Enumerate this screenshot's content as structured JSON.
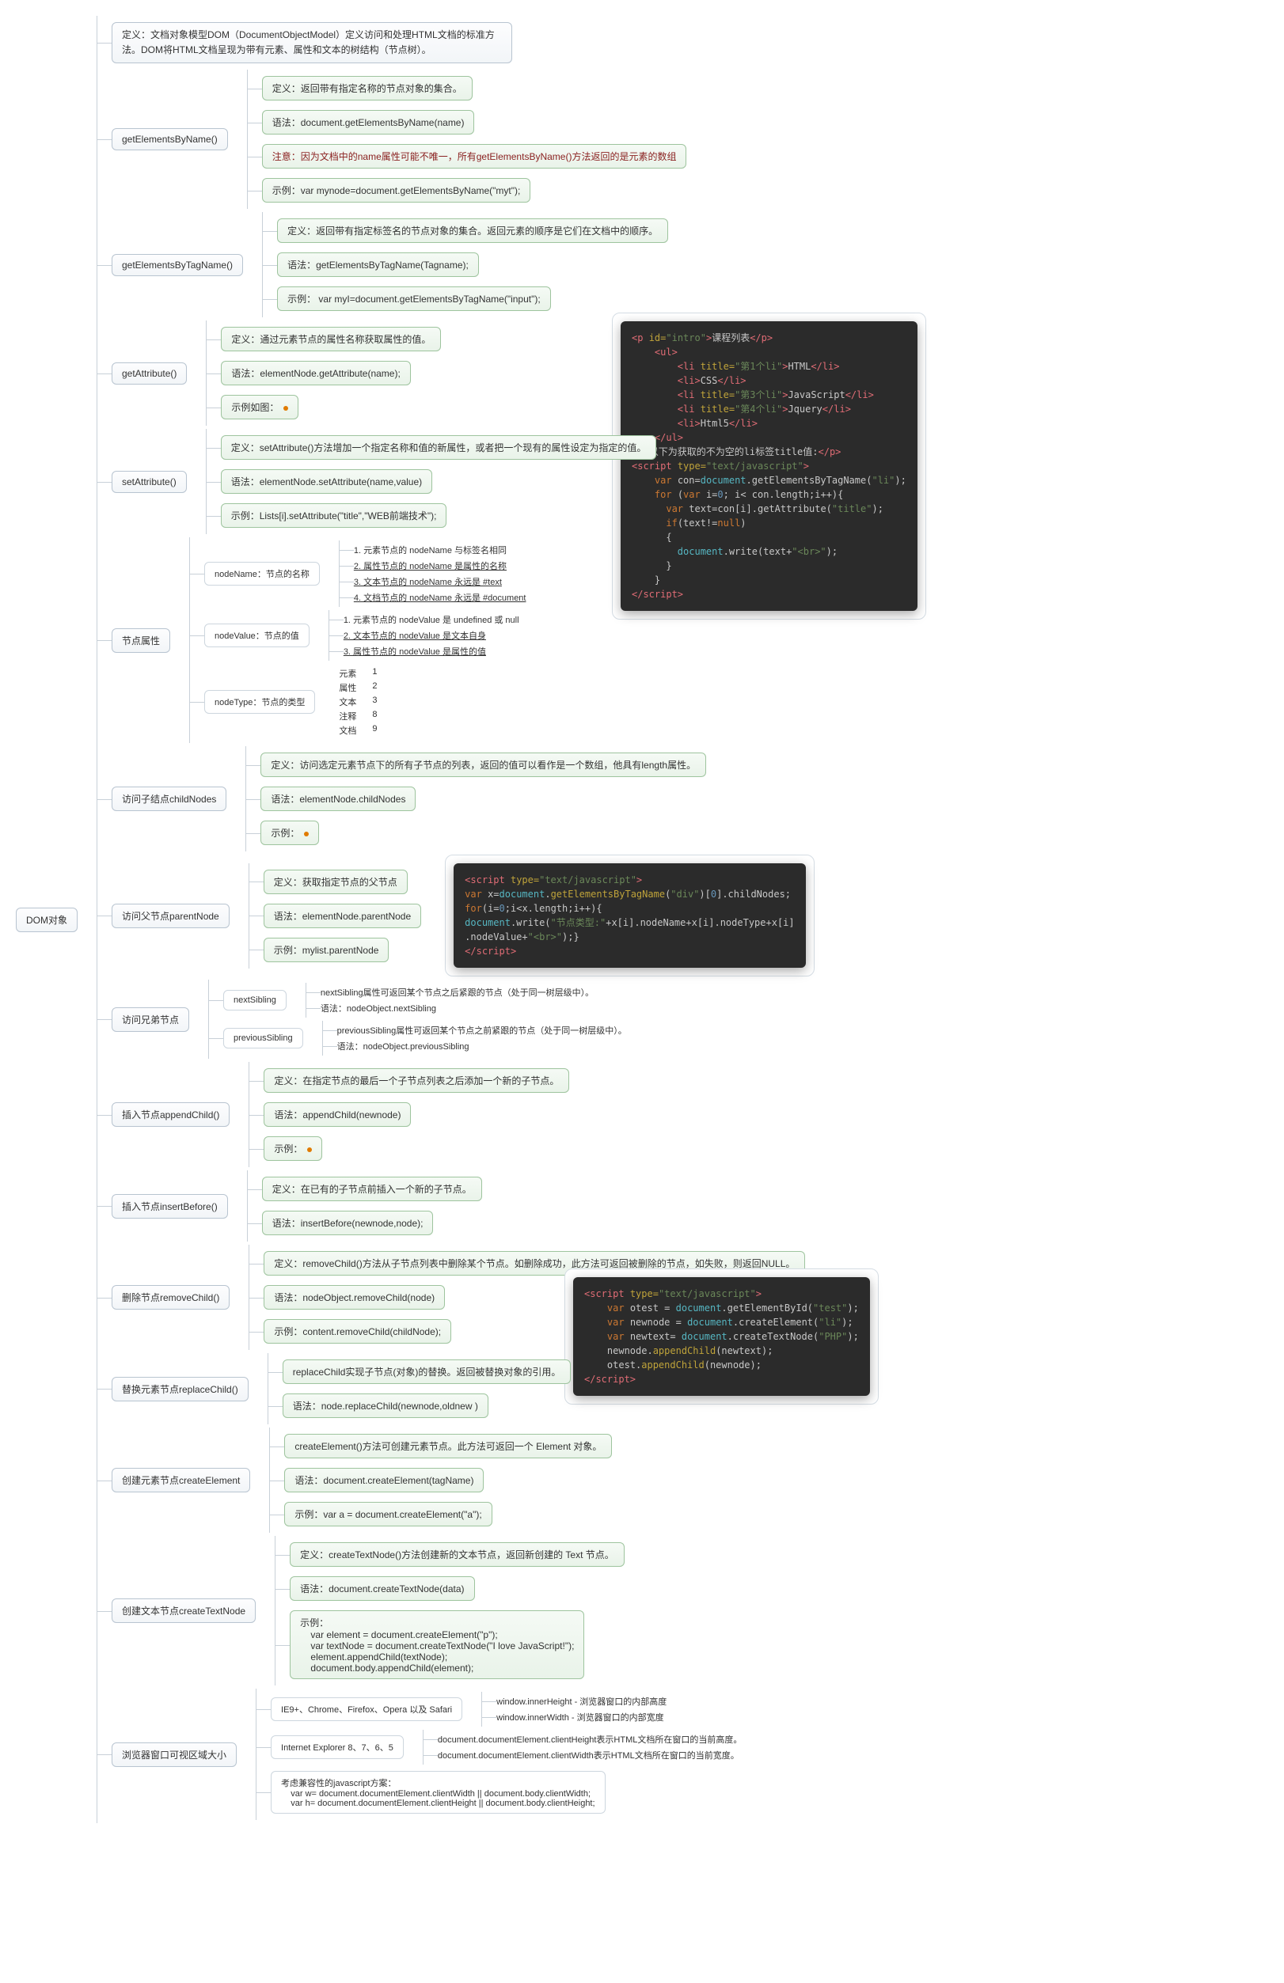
{
  "root": "DOM对象",
  "intro": "定义：文档对象模型DOM（DocumentObjectModel）定义访问和处理HTML文档的标准方法。DOM将HTML文档呈现为带有元素、属性和文本的树结构（节点树）。",
  "getElementsByName": {
    "title": "getElementsByName()",
    "def": "定义：返回带有指定名称的节点对象的集合。",
    "syntax": "语法：document.getElementsByName(name)",
    "note": "注意：因为文档中的name属性可能不唯一，所有getElementsByName()方法返回的是元素的数组",
    "example": "示例：var mynode=document.getElementsByName(\"myt\");"
  },
  "getElementsByTagName": {
    "title": "getElementsByTagName()",
    "def": "定义：返回带有指定标签名的节点对象的集合。返回元素的顺序是它们在文档中的顺序。",
    "syntax": "语法：getElementsByTagName(Tagname);",
    "example": "示例： var myI=document.getElementsByTagName(\"input\");"
  },
  "getAttribute": {
    "title": "getAttribute()",
    "def": "定义：通过元素节点的属性名称获取属性的值。",
    "syntax": "语法：elementNode.getAttribute(name);",
    "example": "示例如图："
  },
  "setAttribute": {
    "title": "setAttribute()",
    "def": "定义：setAttribute()方法增加一个指定名称和值的新属性，或者把一个现有的属性设定为指定的值。",
    "syntax": "语法：elementNode.setAttribute(name,value)",
    "example": "示例：Lists[i].setAttribute(\"title\",\"WEB前端技术\");"
  },
  "nodeProps": {
    "title": "节点属性",
    "nodeName": {
      "title": "nodeName：节点的名称",
      "items": [
        "1. 元素节点的 nodeName 与标签名相同",
        "2. 属性节点的 nodeName 是属性的名称",
        "3. 文本节点的 nodeName 永远是 #text",
        "4. 文档节点的 nodeName 永远是 #document"
      ]
    },
    "nodeValue": {
      "title": "nodeValue：节点的值",
      "items": [
        "1. 元素节点的 nodeValue 是 undefined 或 null",
        "2. 文本节点的 nodeValue 是文本自身",
        "3. 属性节点的 nodeValue 是属性的值"
      ]
    },
    "nodeType": {
      "title": "nodeType：节点的类型",
      "rows": [
        [
          "元素",
          "1"
        ],
        [
          "属性",
          "2"
        ],
        [
          "文本",
          "3"
        ],
        [
          "注释",
          "8"
        ],
        [
          "文档",
          "9"
        ]
      ]
    }
  },
  "childNodes": {
    "title": "访问子结点childNodes",
    "def": "定义：访问选定元素节点下的所有子节点的列表，返回的值可以看作是一个数组，他具有length属性。",
    "syntax": "语法：elementNode.childNodes",
    "example": "示例："
  },
  "parentNode": {
    "title": "访问父节点parentNode",
    "def": "定义：获取指定节点的父节点",
    "syntax": "语法：elementNode.parentNode",
    "example": "示例：mylist.parentNode"
  },
  "siblings": {
    "title": "访问兄弟节点",
    "next": {
      "title": "nextSibling",
      "def": "nextSibling属性可返回某个节点之后紧跟的节点（处于同一树层级中）。",
      "syntax": "语法：nodeObject.nextSibling"
    },
    "prev": {
      "title": "previousSibling",
      "def": "previousSibling属性可返回某个节点之前紧跟的节点（处于同一树层级中）。",
      "syntax": "语法：nodeObject.previousSibling"
    }
  },
  "appendChild": {
    "title": "插入节点appendChild()",
    "def": "定义：在指定节点的最后一个子节点列表之后添加一个新的子节点。",
    "syntax": "语法：appendChild(newnode)",
    "example": "示例："
  },
  "insertBefore": {
    "title": "插入节点insertBefore()",
    "def": "定义：在已有的子节点前插入一个新的子节点。",
    "syntax": "语法：insertBefore(newnode,node);"
  },
  "removeChild": {
    "title": "删除节点removeChild()",
    "def": "定义：removeChild()方法从子节点列表中删除某个节点。如删除成功，此方法可返回被删除的节点，如失败，则返回NULL。",
    "syntax": "语法：nodeObject.removeChild(node)",
    "example": "示例：content.removeChild(childNode);"
  },
  "replaceChild": {
    "title": "替换元素节点replaceChild()",
    "def": "replaceChild实现子节点(对象)的替换。返回被替换对象的引用。",
    "syntax": "语法：node.replaceChild(newnode,oldnew )"
  },
  "createElement": {
    "title": "创建元素节点createElement",
    "def": "createElement()方法可创建元素节点。此方法可返回一个 Element 对象。",
    "syntax": "语法：document.createElement(tagName)",
    "example": "示例：var a = document.createElement(\"a\");"
  },
  "createTextNode": {
    "title": "创建文本节点createTextNode",
    "def": "定义：createTextNode()方法创建新的文本节点，返回新创建的 Text 节点。",
    "syntax": "语法：document.createTextNode(data)",
    "example": "示例：\n    var element = document.createElement(\"p\");\n    var textNode = document.createTextNode(\"I love JavaScript!\");\n    element.appendChild(textNode);\n    document.body.appendChild(element);"
  },
  "viewport": {
    "title": "浏览器窗口可视区域大小",
    "modern": {
      "title": "IE9+、Chrome、Firefox、Opera 以及 Safari",
      "h": "window.innerHeight - 浏览器窗口的内部高度",
      "w": "window.innerWidth - 浏览器窗口的内部宽度"
    },
    "ie": {
      "title": "Internet Explorer 8、7、6、5",
      "h": "document.documentElement.clientHeight表示HTML文档所在窗口的当前高度。",
      "w": "document.documentElement.clientWidth表示HTML文档所在窗口的当前宽度。"
    },
    "compat": "考虑兼容性的javascript方案：\n    var w= document.documentElement.clientWidth || document.body.clientWidth;\n    var h= document.documentElement.clientHeight || document.body.clientHeight;"
  },
  "code1": "<p id=\"intro\">课程列表</p>\n    <ul>\n        <li title=\"第1个li\">HTML</li>\n        <li>CSS</li>\n        <li title=\"第3个li\">JavaScript</li>\n        <li title=\"第4个li\">Jquery</li>\n        <li>Html5</li>\n    </ul>\n<p>以下为获取的不为空的li标签title值:</p>\n<script type=\"text/javascript\">\n    var con=document.getElementsByTagName(\"li\");\n    for (var i=0; i< con.length;i++){\n      var text=con[i].getAttribute(\"title\");\n      if(text!=null)\n      {\n        document.write(text+\"<br>\");\n      }\n    }\n</script>",
  "code2": "<script type=\"text/javascript\">\nvar x=document.getElementsByTagName(\"div\")[0].childNodes;\nfor(i=0;i<x.length;i++){\ndocument.write(\"节点类型:\"+x[i].nodeName+x[i].nodeType+x[i]\n.nodeValue+\"<br>\");}\n</script>",
  "code3": "<script type=\"text/javascript\">\n    var otest = document.getElementById(\"test\");\n    var newnode = document.createElement(\"li\");\n    var newtext= document.createTextNode(\"PHP\");\n    newnode.appendChild(newtext);\n    otest.appendChild(newnode);\n</script>"
}
